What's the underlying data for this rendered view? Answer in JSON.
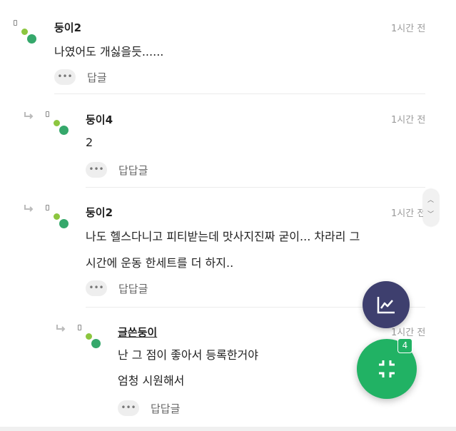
{
  "comments": [
    {
      "author": "둥이2",
      "time": "1시간 전",
      "lines": [
        "나였어도 개싫을듯......"
      ],
      "reply_label": "답글",
      "more_icon": "ellipsis-icon"
    },
    {
      "author": "둥이4",
      "time": "1시간 전",
      "lines": [
        "2"
      ],
      "reply_label": "답답글",
      "more_icon": "ellipsis-icon"
    },
    {
      "author": "둥이2",
      "time": "1시간 전",
      "lines": [
        "나도 헬스다니고 피티받는데 맛사지진짜 굳이... 차라리 그",
        "시간에 운동 한세트를 더 하지.."
      ],
      "reply_label": "답답글",
      "more_icon": "ellipsis-icon"
    },
    {
      "author": "글쓴둥이",
      "time": "1시간 전",
      "lines": [
        "난 그 점이 좋아서 등록한거야",
        "엄청 시원해서"
      ],
      "reply_label": "답답글",
      "more_icon": "ellipsis-icon"
    }
  ],
  "more_glyph": "•••",
  "fab": {
    "chart_icon": "trend-chart-icon",
    "collapse_icon": "collapse-icon",
    "badge_count": "4"
  },
  "colors": {
    "fab_chart": "#3e3f6e",
    "fab_collapse": "#21b264",
    "avatar_light": "#8cc63f",
    "avatar_dark": "#35a86b"
  }
}
